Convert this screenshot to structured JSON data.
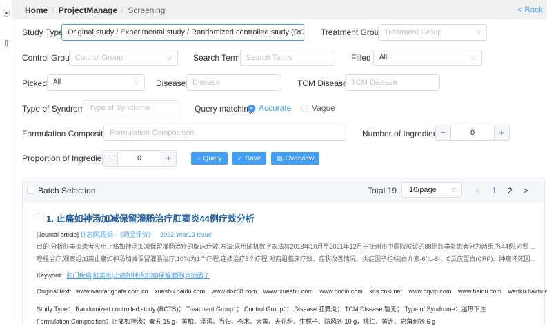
{
  "breadcrumb": {
    "home": "Home",
    "project": "ProjectManage",
    "current": "Screening"
  },
  "back_label": "< Back",
  "form": {
    "study_type": {
      "label": "Study Type",
      "value": "Original study / Experimental study / Randomized controlled study (RCTS"
    },
    "treatment_group": {
      "label": "Treatment Group",
      "placeholder": "Treatment Group"
    },
    "control_group": {
      "label": "Control Group",
      "placeholder": "Control Group"
    },
    "search_terms": {
      "label": "Search Terms",
      "placeholder": "Search Terms"
    },
    "filled": {
      "label": "Filled",
      "value": "All"
    },
    "picked": {
      "label": "Picked",
      "value": "All"
    },
    "disease": {
      "label": "Disease",
      "placeholder": "Disease"
    },
    "tcm_disease": {
      "label": "TCM Disease",
      "placeholder": "TCM Disease"
    },
    "type_of_syndrome": {
      "label": "Type of Syndrome",
      "placeholder": "Type of Syndrome"
    },
    "query_matching": {
      "label": "Query matching",
      "options": [
        "Accurate",
        "Vague"
      ],
      "selected": "Accurate"
    },
    "formulation_composition": {
      "label": "Formulation Composition",
      "placeholder": "Formulation Composition"
    },
    "number_of_ingredients": {
      "label": "Number of Ingredients",
      "value": "0",
      "minus": "−",
      "plus": "+"
    },
    "proportion_of_ingredients": {
      "label": "Proportion of Ingredients",
      "value": "0",
      "minus": "−",
      "plus": "+"
    }
  },
  "actions": {
    "query": "Query",
    "save": "Save",
    "overview": "Overview"
  },
  "results": {
    "batch_selection": "Batch Selection",
    "total": "Total 19",
    "page_size": "10/page",
    "prev": "<",
    "pages": [
      "1",
      "2"
    ],
    "current_page": "1",
    "next": ">",
    "item": {
      "title": "1. 止痛如神汤加减保留灌肠治疗肛窦炎44例疗效分析",
      "type": "[Journal article]",
      "authors": "许志辉,周娟",
      "journal": "-《药品评价》",
      "year": "2022 Year13 Issue",
      "abstract_1": "目的:分析肛窦炎患者应用止痛如神汤加减保留灌肠治疗的临床疗效.方法:采用随机数字表法将2018年10月至2021年12月于抚州市中医院就诊的88例肛窦炎患者分为两组,各44例.对照组予以甲硝",
      "abstract_2": "唑栓治疗,观察组加用止痛如神汤加减保留灌肠治疗,10?d为1个疗程,连续治疗3个疗程.对两组临床疗效、症状改善情况、炎症因子指标[白介素-6(IL-6)、C反应蛋白(CRP)、肿瘤坏死因子(TNF-α)...",
      "keyword_label": "Keyword:",
      "keywords": "肛门疾病|肛窦炎|止痛如神汤加减|保留灌肠|炎症因子",
      "original_text_label": "Original text:",
      "sources": [
        "www.wanfangdata.com.cn",
        "xueshu.baidu.com",
        "www.doc88.com",
        "www.ixueshu.com",
        "www.docin.com",
        "kns.cnki.net",
        "www.cqvip.com",
        "www.baidu.com",
        "wenku.baidu.com"
      ],
      "study_line": "Study Type： Randomized controlled study (RCTS)； Treatment Group：； Control Group：； Disease:肛窦炎； TCM Disease:暂无； Type of Syndrome：湿热下注",
      "formulation_line": "Formulation Composition：止痛如神汤：秦艽 15 g，黄柏、泽泻、当归、苍术、大黄、天花粉、生栀子、防风各 10 g，桃仁、黄连、皂角刺各 6 g"
    }
  }
}
